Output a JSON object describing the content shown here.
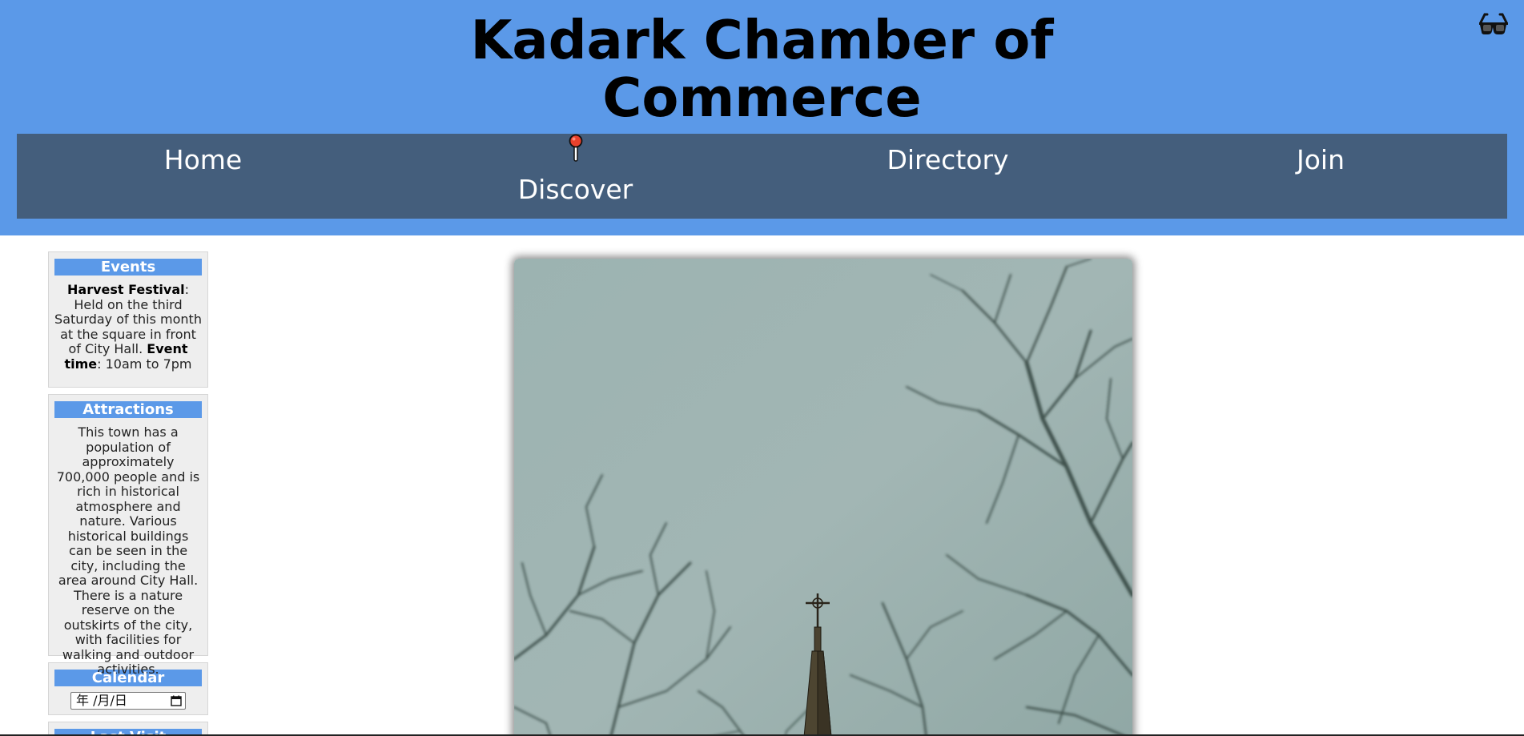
{
  "site": {
    "title_line1": "Kadark Chamber of",
    "title_line2": "Commerce",
    "accent_color": "#5b99e8",
    "nav_color": "#445e7c"
  },
  "header": {
    "accessibility_icon": "glasses-icon"
  },
  "nav": {
    "home": "Home",
    "discover": "Discover",
    "directory": "Directory",
    "join": "Join",
    "discover_icon": "pin-icon"
  },
  "sidebar": {
    "events": {
      "heading": "Events",
      "event_name": "Harvest Festival",
      "event_desc": ": Held on the third Saturday of this month at the square in front of City Hall. ",
      "time_label": "Event time",
      "time_value": ": 10am to 7pm"
    },
    "attractions": {
      "heading": "Attractions",
      "body": "This town has a population of approximately 700,000 people and is rich in historical atmosphere and nature. Various historical buildings can be seen in the city, including the area around City Hall. There is a nature reserve on the outskirts of the city, with facilities for walking and outdoor activities."
    },
    "calendar": {
      "heading": "Calendar",
      "date_placeholder": "年 /月/日"
    },
    "last_visit": {
      "heading": "Last Visit"
    }
  }
}
